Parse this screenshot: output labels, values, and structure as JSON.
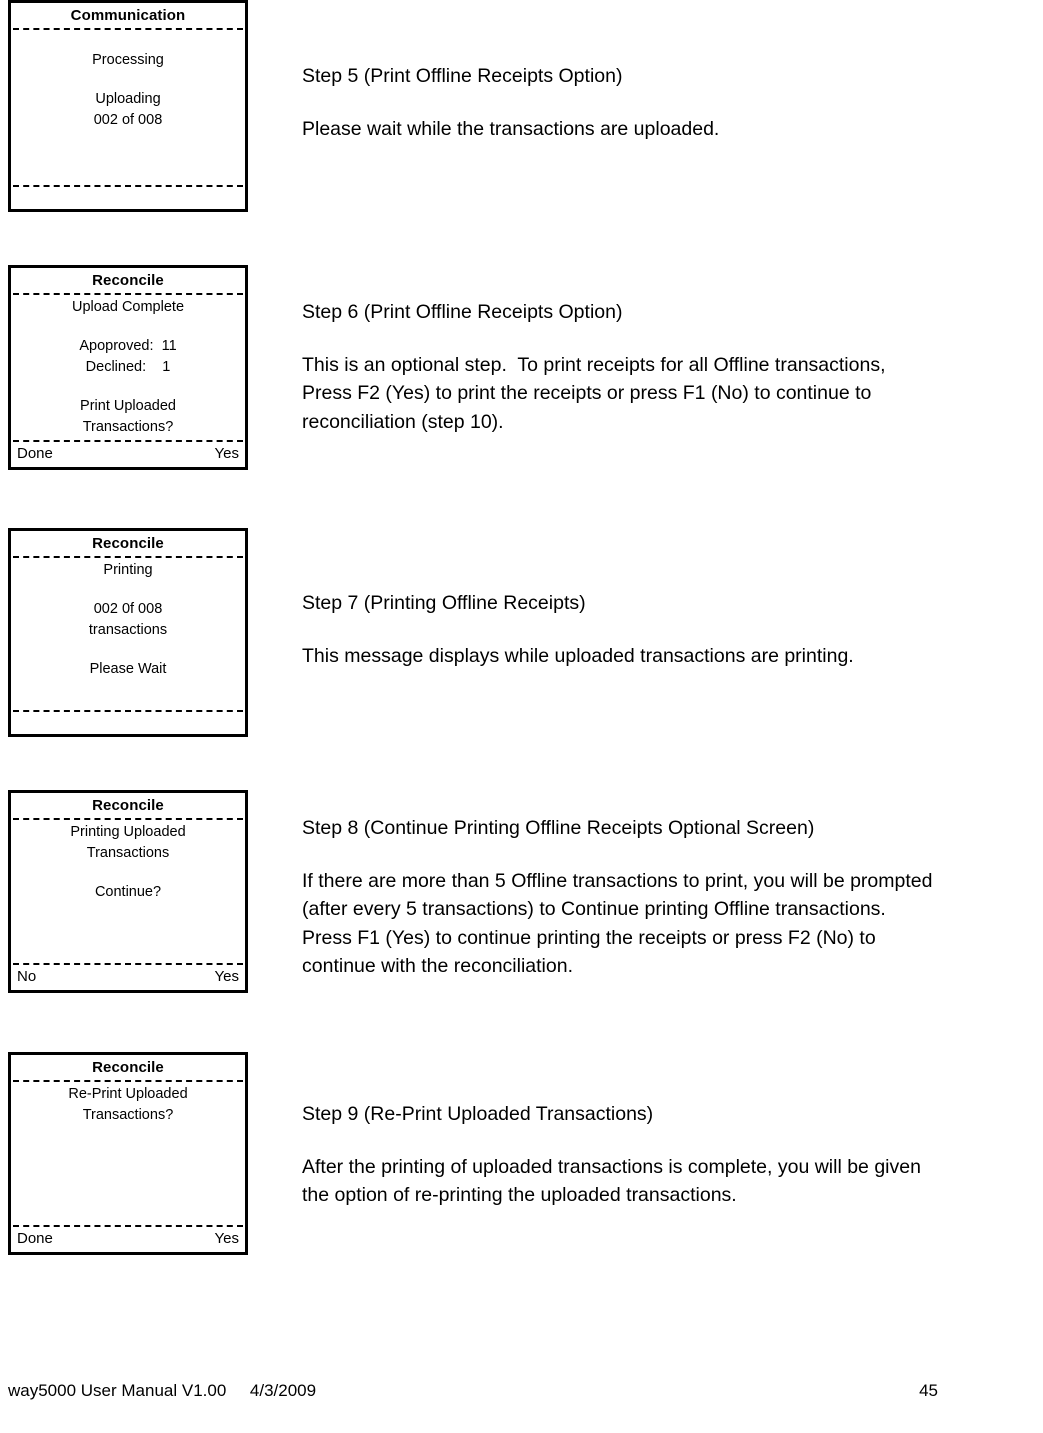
{
  "document": {
    "footer": {
      "left": "way5000 User Manual V1.00     4/3/2009",
      "page_number": "45"
    }
  },
  "screens": [
    {
      "name": "communication-uploading",
      "title": "Communication",
      "body_lines": [
        "Processing",
        "",
        "Uploading",
        "002 of 008"
      ],
      "softkey_left": "",
      "softkey_right": ""
    },
    {
      "name": "reconcile-upload-complete",
      "title": "Reconcile",
      "body_lines": [
        "Upload Complete",
        "",
        "Apoproved:  11",
        "Declined:    1",
        "",
        "Print Uploaded",
        "Transactions?"
      ],
      "softkey_left": "Done",
      "softkey_right": "Yes"
    },
    {
      "name": "reconcile-printing",
      "title": "Reconcile",
      "body_lines": [
        "Printing",
        "",
        "002 0f 008",
        "transactions",
        "",
        "Please Wait"
      ],
      "softkey_left": "",
      "softkey_right": ""
    },
    {
      "name": "reconcile-continue-printing",
      "title": "Reconcile",
      "body_lines": [
        "Printing Uploaded",
        "Transactions",
        "",
        "Continue?"
      ],
      "softkey_left": "No",
      "softkey_right": "Yes"
    },
    {
      "name": "reconcile-reprint",
      "title": "Reconcile",
      "body_lines": [
        "Re-Print Uploaded",
        "Transactions?"
      ],
      "softkey_left": "Done",
      "softkey_right": "Yes"
    }
  ],
  "steps": [
    {
      "name": "step-5",
      "heading": "Step 5 (Print Offline Receipts Option)",
      "paragraph_lines": [
        "Please wait while the transactions are uploaded."
      ]
    },
    {
      "name": "step-6",
      "heading": "Step 6 (Print Offline Receipts Option)",
      "paragraph_lines": [
        "This is an optional step.  To print receipts for all Offline transactions,",
        "Press F2 (Yes) to print the receipts or press F1 (No) to continue to",
        "reconciliation (step 10)."
      ]
    },
    {
      "name": "step-7",
      "heading": "Step 7 (Printing Offline Receipts)",
      "paragraph_lines": [
        "This message displays while uploaded transactions are printing."
      ]
    },
    {
      "name": "step-8",
      "heading": "Step 8 (Continue Printing Offline Receipts Optional Screen)",
      "paragraph_lines": [
        "If there are more than 5 Offline transactions to print, you will be prompted",
        "(after every 5 transactions) to Continue printing Offline transactions.",
        "Press F1 (Yes) to continue printing the receipts or press F2 (No) to",
        "continue with the reconciliation."
      ]
    },
    {
      "name": "step-9",
      "heading": "Step 9 (Re-Print Uploaded Transactions)",
      "paragraph_lines": [
        "After the printing of uploaded transactions is complete, you will be given",
        "the option of re-printing the uploaded transactions."
      ]
    }
  ]
}
